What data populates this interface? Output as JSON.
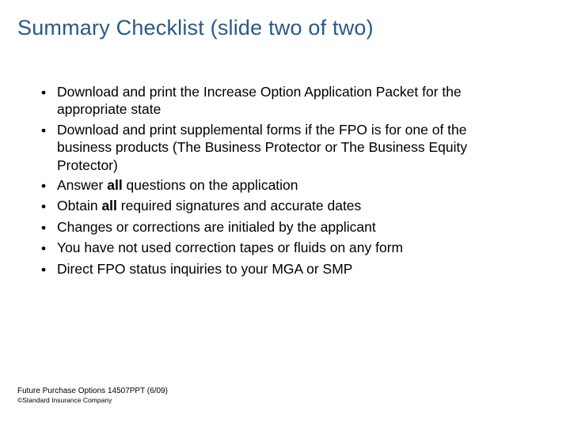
{
  "title": "Summary Checklist (slide two of two)",
  "bullets": [
    {
      "pre": "Download and print the Increase Option Application Packet for the appropriate state",
      "bold": "",
      "post": ""
    },
    {
      "pre": "Download and print supplemental forms if the FPO is for one of the business products (The Business Protector or The Business Equity Protector)",
      "bold": "",
      "post": ""
    },
    {
      "pre": "Answer ",
      "bold": "all",
      "post": " questions on the application"
    },
    {
      "pre": "Obtain ",
      "bold": "all",
      "post": " required signatures and accurate dates"
    },
    {
      "pre": "Changes or corrections are initialed by the applicant",
      "bold": "",
      "post": ""
    },
    {
      "pre": "You have not used correction tapes or fluids on any form",
      "bold": "",
      "post": ""
    },
    {
      "pre": "Direct FPO status inquiries to your MGA or SMP",
      "bold": "",
      "post": ""
    }
  ],
  "footer_line1": "Future Purchase Options 14507PPT (6/09)",
  "footer_line2": "©Standard Insurance Company"
}
